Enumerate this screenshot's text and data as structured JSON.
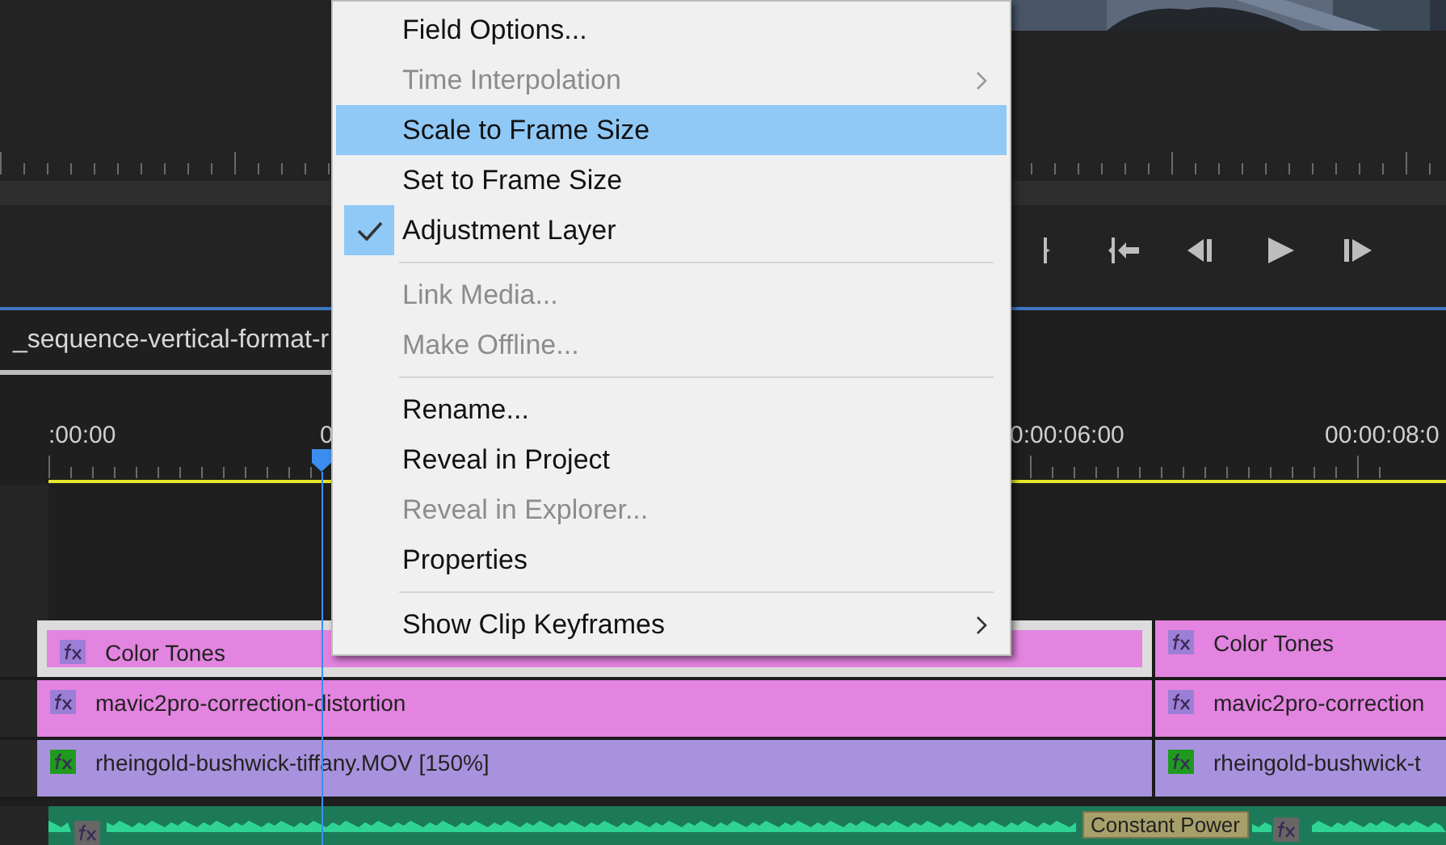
{
  "sequence_tab": {
    "label": "_sequence-vertical-format-r",
    "selected": true
  },
  "ruler": {
    "labels": [
      ":00:00",
      "0",
      "0:00:06:00",
      "00:00:08:0"
    ]
  },
  "tracks": [
    {
      "kind": "video",
      "clips": [
        {
          "label": "Color Tones",
          "color": "#9b7fd6",
          "selected": true
        },
        {
          "label": "Color Tones",
          "color": "#9b7fd6",
          "selected": false
        }
      ],
      "color": "#e384e0"
    },
    {
      "kind": "video",
      "clips": [
        {
          "label": "mavic2pro-correction-distortion",
          "color": "#9b7fd6",
          "selected": false
        },
        {
          "label": "mavic2pro-correction",
          "color": "#9b7fd6",
          "selected": false
        }
      ],
      "color": "#e384e0"
    },
    {
      "kind": "video",
      "clips": [
        {
          "label": "rheingold-bushwick-tiffany.MOV [150%]",
          "color": "#1f9a1f",
          "selected": false
        },
        {
          "label": "rheingold-bushwick-t",
          "color": "#1f9a1f",
          "selected": false
        }
      ],
      "color": "#a892dd"
    },
    {
      "kind": "audio",
      "transition": "Constant Power",
      "color": "#1d7a58"
    }
  ],
  "context_menu": [
    {
      "kind": "item",
      "label": "Field Options...",
      "disabled": false,
      "selected": false,
      "checked": false,
      "submenu": false
    },
    {
      "kind": "item",
      "label": "Time Interpolation",
      "disabled": true,
      "selected": false,
      "checked": false,
      "submenu": true
    },
    {
      "kind": "item",
      "label": "Scale to Frame Size",
      "disabled": false,
      "selected": true,
      "checked": false,
      "submenu": false
    },
    {
      "kind": "item",
      "label": "Set to Frame Size",
      "disabled": false,
      "selected": false,
      "checked": false,
      "submenu": false
    },
    {
      "kind": "item",
      "label": "Adjustment Layer",
      "disabled": false,
      "selected": false,
      "checked": true,
      "submenu": false
    },
    {
      "kind": "separator"
    },
    {
      "kind": "item",
      "label": "Link Media...",
      "disabled": true,
      "selected": false,
      "checked": false,
      "submenu": false
    },
    {
      "kind": "item",
      "label": "Make Offline...",
      "disabled": true,
      "selected": false,
      "checked": false,
      "submenu": false
    },
    {
      "kind": "separator"
    },
    {
      "kind": "item",
      "label": "Rename...",
      "disabled": false,
      "selected": false,
      "checked": false,
      "submenu": false
    },
    {
      "kind": "item",
      "label": "Reveal in Project",
      "disabled": false,
      "selected": false,
      "checked": false,
      "submenu": false
    },
    {
      "kind": "item",
      "label": "Reveal in Explorer...",
      "disabled": true,
      "selected": false,
      "checked": false,
      "submenu": false
    },
    {
      "kind": "item",
      "label": "Properties",
      "disabled": false,
      "selected": false,
      "checked": false,
      "submenu": false
    },
    {
      "kind": "separator"
    },
    {
      "kind": "item",
      "label": "Show Clip Keyframes",
      "disabled": false,
      "selected": false,
      "checked": false,
      "submenu": true
    }
  ]
}
